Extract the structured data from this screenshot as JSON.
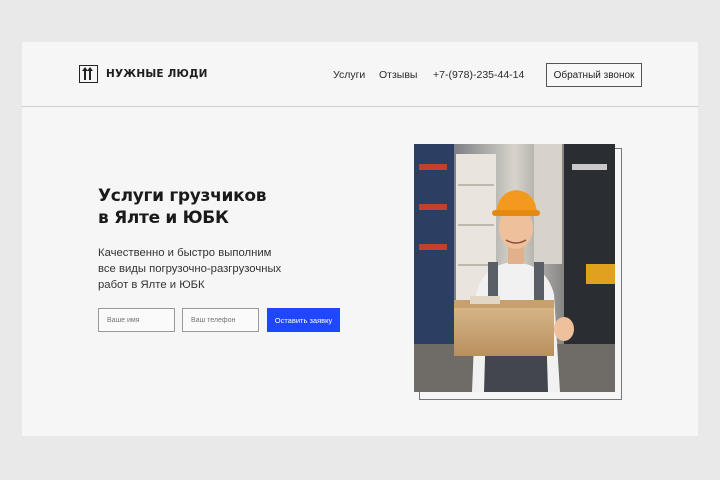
{
  "header": {
    "logo_text": "НУЖНЫЕ ЛЮДИ",
    "nav": {
      "services": "Услуги",
      "reviews": "Отзывы",
      "phone": "+7-(978)-235-44-14"
    },
    "callback_label": "Обратный звонок"
  },
  "hero": {
    "title_line1": "Услуги грузчиков",
    "title_line2": "в Ялте и ЮБК",
    "subtitle_line1": "Качественно и быстро выполним",
    "subtitle_line2": "все виды погрузочно-разгрузочных",
    "subtitle_line3": "работ в Ялте и ЮБК"
  },
  "form": {
    "name_placeholder": "Ваше имя",
    "phone_placeholder": "Ваш телефон",
    "submit_label": "Оставить заявку"
  },
  "colors": {
    "accent": "#1f47ff",
    "background": "#e9e9e9",
    "card": "#f6f6f6"
  },
  "icons": {
    "logo": "dolly-arrows-icon"
  }
}
